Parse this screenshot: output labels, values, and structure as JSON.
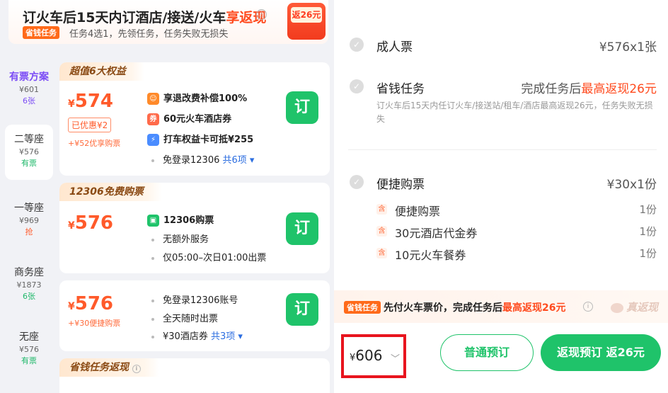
{
  "promo": {
    "title_prefix": "订火车后15天内订酒店/接送/火车",
    "title_highlight": "享返现",
    "info_icon": "ⓘ",
    "task_badge": "省钱任务",
    "task_text": "任务4选1，先领任务，任务失败无损失",
    "coupon_label": "返26元"
  },
  "seats": [
    {
      "name": "有票方案",
      "price": "¥601",
      "status": "6张",
      "status_color": "#7b4cf5"
    },
    {
      "name": "二等座",
      "price": "¥576",
      "status": "有票",
      "status_color": "#1fb86a"
    },
    {
      "name": "一等座",
      "price": "¥969",
      "status": "抢",
      "status_color": "#ff5a2a"
    },
    {
      "name": "商务座",
      "price": "¥1873",
      "status": "6张",
      "status_color": "#1fb86a"
    },
    {
      "name": "无座",
      "price": "¥576",
      "status": "有票",
      "status_color": "#1fb86a"
    }
  ],
  "cards": {
    "c1": {
      "title": "超值6大权益",
      "price": "574",
      "discount": "已优惠¥2",
      "note": "+¥52优享购票",
      "f1": "享退改费补偿100%",
      "f2": "60元火车酒店券",
      "f3": "打车权益卡可抵¥255",
      "f4": "免登录12306",
      "f4_more": "共6项 ▾",
      "order": "订"
    },
    "c2": {
      "title": "12306免费购票",
      "price": "576",
      "f1": "12306购票",
      "f2": "无额外服务",
      "f3": "仅05:00–次日01:00出票",
      "order": "订"
    },
    "c3": {
      "price": "576",
      "note": "+¥30便捷购票",
      "f1": "免登录12306账号",
      "f2": "全天随时出票",
      "f3": "¥30酒店券",
      "f3_more": "共3项 ▾",
      "order": "订"
    },
    "c4": {
      "title": "省钱任务返现"
    }
  },
  "summary": {
    "adult_label": "成人票",
    "adult_value": "¥576x1张",
    "task_label": "省钱任务",
    "task_value_prefix": "完成任务后",
    "task_value_highlight": "最高返现26元",
    "task_desc": "订火车后15天内任订火车/接送站/租车/酒店最高返现26元，任务失败无损失",
    "fast_label": "便捷购票",
    "fast_value": "¥30x1份",
    "items": [
      {
        "name": "便捷购票",
        "qty": "1份"
      },
      {
        "name": "30元酒店代金券",
        "qty": "1份"
      },
      {
        "name": "10元火车餐券",
        "qty": "1份"
      }
    ]
  },
  "banner": {
    "badge": "省钱任务",
    "text_prefix": "先付火车票价，完成任务后",
    "text_highlight": "最高返现26元",
    "truth": "真返现"
  },
  "bottom": {
    "total_yen": "¥",
    "total": "606",
    "normal_button": "普通预订",
    "cashback_button": "返现预订  返26元"
  },
  "colors": {
    "accent_green": "#1fc36a",
    "accent_orange": "#ff5a2a",
    "highlight_box": "#e8141e"
  }
}
